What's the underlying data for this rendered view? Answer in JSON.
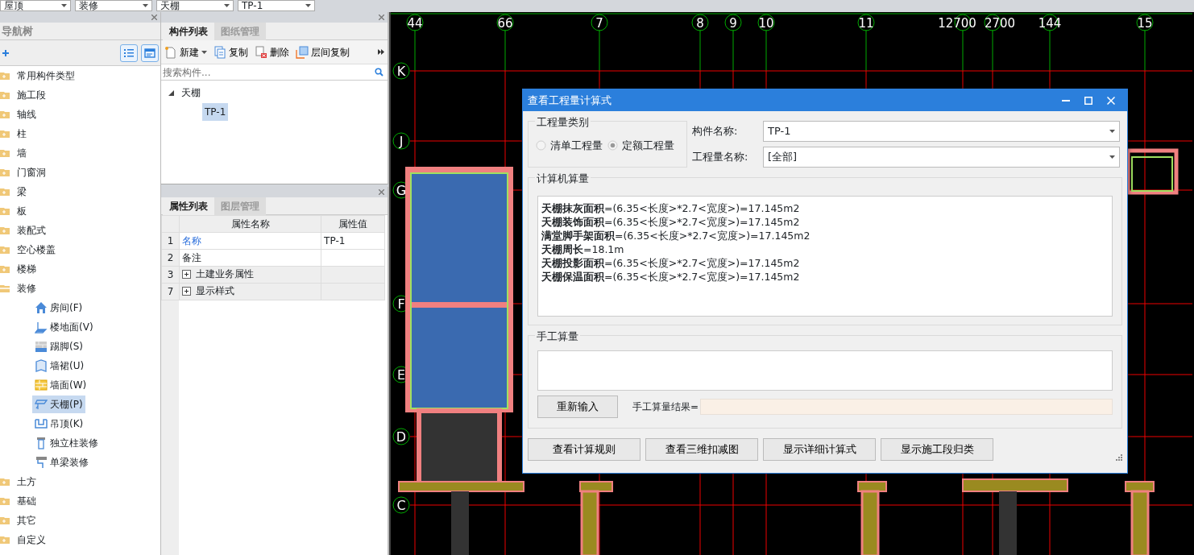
{
  "top_selectors": [
    "屋顶",
    "装修",
    "天棚",
    "TP-1"
  ],
  "nav_panel": {
    "title": "导航树",
    "items": [
      {
        "label": "常用构件类型",
        "expanded": false
      },
      {
        "label": "施工段",
        "expanded": false
      },
      {
        "label": "轴线",
        "expanded": false
      },
      {
        "label": "柱",
        "expanded": false
      },
      {
        "label": "墙",
        "expanded": false
      },
      {
        "label": "门窗洞",
        "expanded": false
      },
      {
        "label": "梁",
        "expanded": false
      },
      {
        "label": "板",
        "expanded": false
      },
      {
        "label": "装配式",
        "expanded": false
      },
      {
        "label": "空心楼盖",
        "expanded": false
      },
      {
        "label": "楼梯",
        "expanded": false
      },
      {
        "label": "装修",
        "expanded": true,
        "children": [
          {
            "label": "房间(F)",
            "selected": false
          },
          {
            "label": "楼地面(V)",
            "selected": false
          },
          {
            "label": "踢脚(S)",
            "selected": false
          },
          {
            "label": "墙裙(U)",
            "selected": false
          },
          {
            "label": "墙面(W)",
            "selected": false
          },
          {
            "label": "天棚(P)",
            "selected": true
          },
          {
            "label": "吊顶(K)",
            "selected": false
          },
          {
            "label": "独立柱装修",
            "selected": false
          },
          {
            "label": "单梁装修",
            "selected": false
          }
        ]
      },
      {
        "label": "土方",
        "expanded": false
      },
      {
        "label": "基础",
        "expanded": false
      },
      {
        "label": "其它",
        "expanded": false
      },
      {
        "label": "自定义",
        "expanded": false
      }
    ]
  },
  "component_panel": {
    "tabs": [
      {
        "label": "构件列表",
        "selected": true
      },
      {
        "label": "图纸管理",
        "selected": false
      }
    ],
    "toolbar": [
      "新建",
      "复制",
      "删除",
      "层间复制"
    ],
    "search": {
      "placeholder": "搜索构件..."
    },
    "tree": [
      {
        "label": "天棚",
        "expanded": true,
        "children": [
          {
            "label": "TP-1",
            "selected": true
          }
        ]
      }
    ]
  },
  "property_panel": {
    "tabs": [
      {
        "label": "属性列表",
        "selected": true
      },
      {
        "label": "图层管理",
        "selected": false
      }
    ],
    "columns": [
      "属性名称",
      "属性值"
    ],
    "rows": [
      {
        "num": "1",
        "name": "名称",
        "value": "TP-1",
        "kind": "key"
      },
      {
        "num": "2",
        "name": "备注",
        "value": "",
        "kind": "plain"
      },
      {
        "num": "3",
        "name": "土建业务属性",
        "value": "",
        "kind": "group"
      },
      {
        "num": "7",
        "name": "显示样式",
        "value": "",
        "kind": "group"
      }
    ]
  },
  "canvas": {
    "x_axes": [
      "44",
      "66",
      "7",
      "8",
      "9",
      "10",
      "11",
      "12700",
      "2700",
      "144",
      "15"
    ],
    "y_axes": [
      "K",
      "J",
      "G",
      "F",
      "E",
      "D",
      "C"
    ]
  },
  "dialog": {
    "title": "查看工程量计算式",
    "quantity_type": {
      "legend": "工程量类别",
      "options": [
        {
          "label": "清单工程量",
          "selected": false
        },
        {
          "label": "定额工程量",
          "selected": true
        }
      ]
    },
    "fields": [
      {
        "label": "构件名称:",
        "value": "TP-1"
      },
      {
        "label": "工程量名称:",
        "value": "[全部]"
      }
    ],
    "computed": {
      "legend": "计算机算量",
      "lines": [
        "**天棚抹灰面积**=(6.35<长度>*2.7<宽度>)=17.145m2",
        "**天棚装饰面积**=(6.35<长度>*2.7<宽度>)=17.145m2",
        "**满堂脚手架面积**=(6.35<长度>*2.7<宽度>)=17.145m2",
        "**天棚周长**=18.1m",
        "**天棚投影面积**=(6.35<长度>*2.7<宽度>)=17.145m2",
        "**天棚保温面积**=(6.35<长度>*2.7<宽度>)=17.145m2"
      ]
    },
    "manual": {
      "legend": "手工算量",
      "reset_button": "重新输入",
      "result_label": "手工算量结果="
    },
    "buttons": [
      "查看计算规则",
      "查看三维扣减图",
      "显示详细计算式",
      "显示施工段归类"
    ]
  }
}
